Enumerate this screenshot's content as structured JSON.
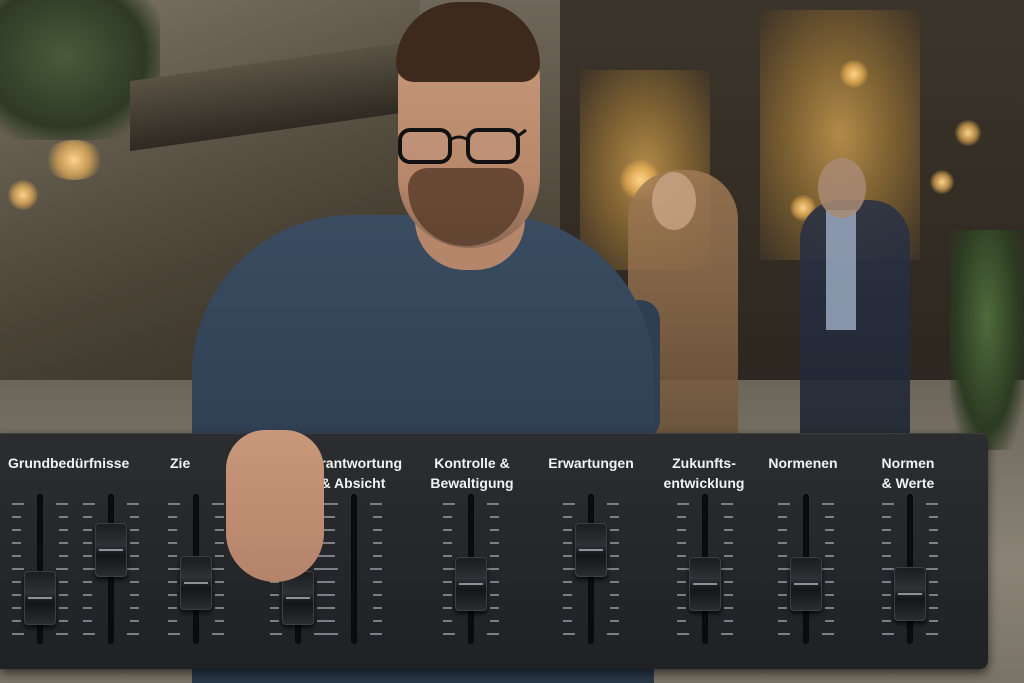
{
  "mixer": {
    "channels": [
      {
        "label": "Grundbedürfnisse",
        "level": 0.23
      },
      {
        "label": "",
        "level": 0.68
      },
      {
        "label": "Zie",
        "level": 0.37
      },
      {
        "label": "",
        "level": 0.23
      },
      {
        "label": "Verantwortung\n& Absicht",
        "level": null
      },
      {
        "label": "Kontrolle &\nBewaltigung",
        "level": 0.36
      },
      {
        "label": "Erwartungen",
        "level": 0.68
      },
      {
        "label": "Zukunfts-\nentwicklung",
        "level": 0.36
      },
      {
        "label": "Normenen",
        "level": 0.36
      },
      {
        "label": "Normen\n& Werte",
        "level": 0.26
      }
    ]
  },
  "colors": {
    "panel": "#25272b",
    "label_text": "#f2f2f2",
    "sweater": "#33455a"
  }
}
